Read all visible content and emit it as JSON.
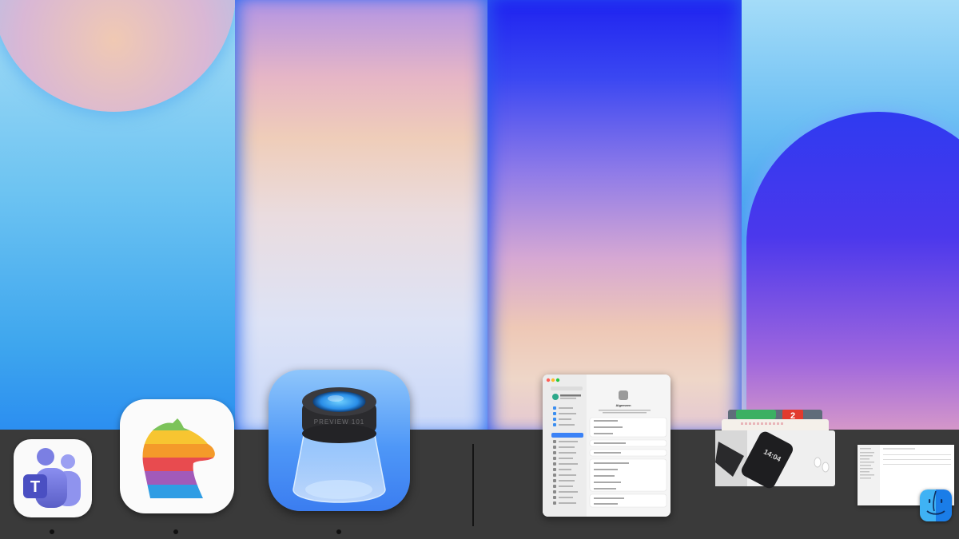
{
  "dock": {
    "apps": [
      {
        "name": "Microsoft Teams",
        "icon": "teams-icon",
        "running": true,
        "badge_letter": "T"
      },
      {
        "name": "Bear",
        "icon": "bear-icon",
        "running": true
      },
      {
        "name": "Preview",
        "icon": "preview-icon",
        "running": true,
        "lens_text": "PREVIEW 101"
      }
    ],
    "minimized_windows": [
      {
        "name": "System Settings",
        "icon": "settings-window-thumbnail",
        "title": "Algemeen"
      },
      {
        "name": "Photos",
        "icon": "photos-window-thumbnail",
        "badge": "2",
        "lock_time": "14:04"
      },
      {
        "name": "Finder",
        "icon": "finder-window-thumbnail"
      }
    ]
  },
  "colors": {
    "dock_bg": "#3a3a3a",
    "preview_blue": "#4e97f7",
    "teams_purple": "#5b5fc7"
  }
}
